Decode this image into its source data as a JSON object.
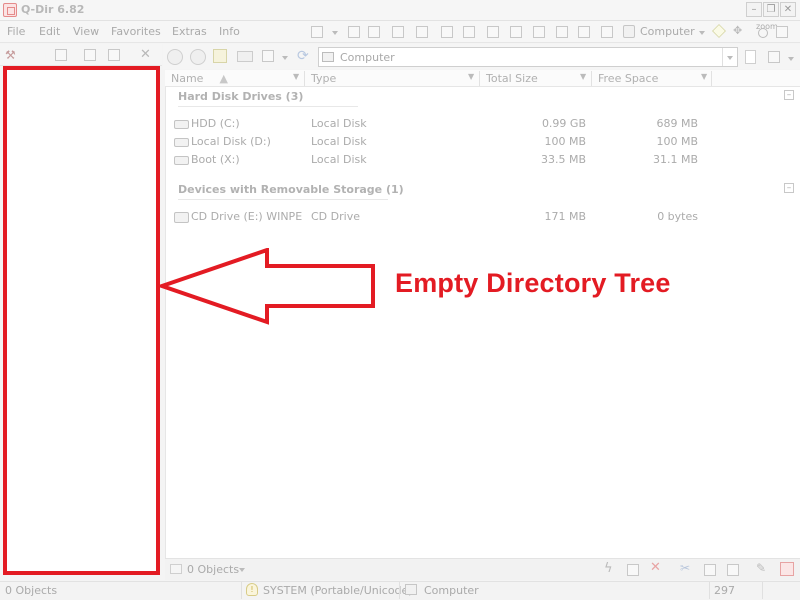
{
  "window": {
    "title": "Q-Dir 6.82"
  },
  "menu": [
    "File",
    "Edit",
    "View",
    "Favorites",
    "Extras",
    "Info"
  ],
  "toolbar": {
    "computer_label": "Computer",
    "zoom_label": "zoom"
  },
  "address": {
    "value": "Computer"
  },
  "columns": [
    "Name",
    "Type",
    "Total Size",
    "Free Space"
  ],
  "groups": [
    {
      "title": "Hard Disk Drives (3)",
      "rows": [
        {
          "name": "HDD (C:)",
          "type": "Local Disk",
          "total": "0.99 GB",
          "free": "689 MB"
        },
        {
          "name": "Local Disk (D:)",
          "type": "Local Disk",
          "total": "100 MB",
          "free": "100 MB"
        },
        {
          "name": "Boot (X:)",
          "type": "Local Disk",
          "total": "33.5 MB",
          "free": "31.1 MB"
        }
      ]
    },
    {
      "title": "Devices with Removable Storage (1)",
      "rows": [
        {
          "name": "CD Drive (E:) WINPE",
          "type": "CD Drive",
          "total": "171 MB",
          "free": "0 bytes"
        }
      ]
    }
  ],
  "annotation": "Empty Directory Tree",
  "list_status": "0 Objects",
  "statusbar": {
    "objects": "0 Objects",
    "system": "SYSTEM (Portable/Unicode)",
    "location": "Computer",
    "count": "297"
  },
  "colors": {
    "annotation_red": "#e31b23"
  }
}
